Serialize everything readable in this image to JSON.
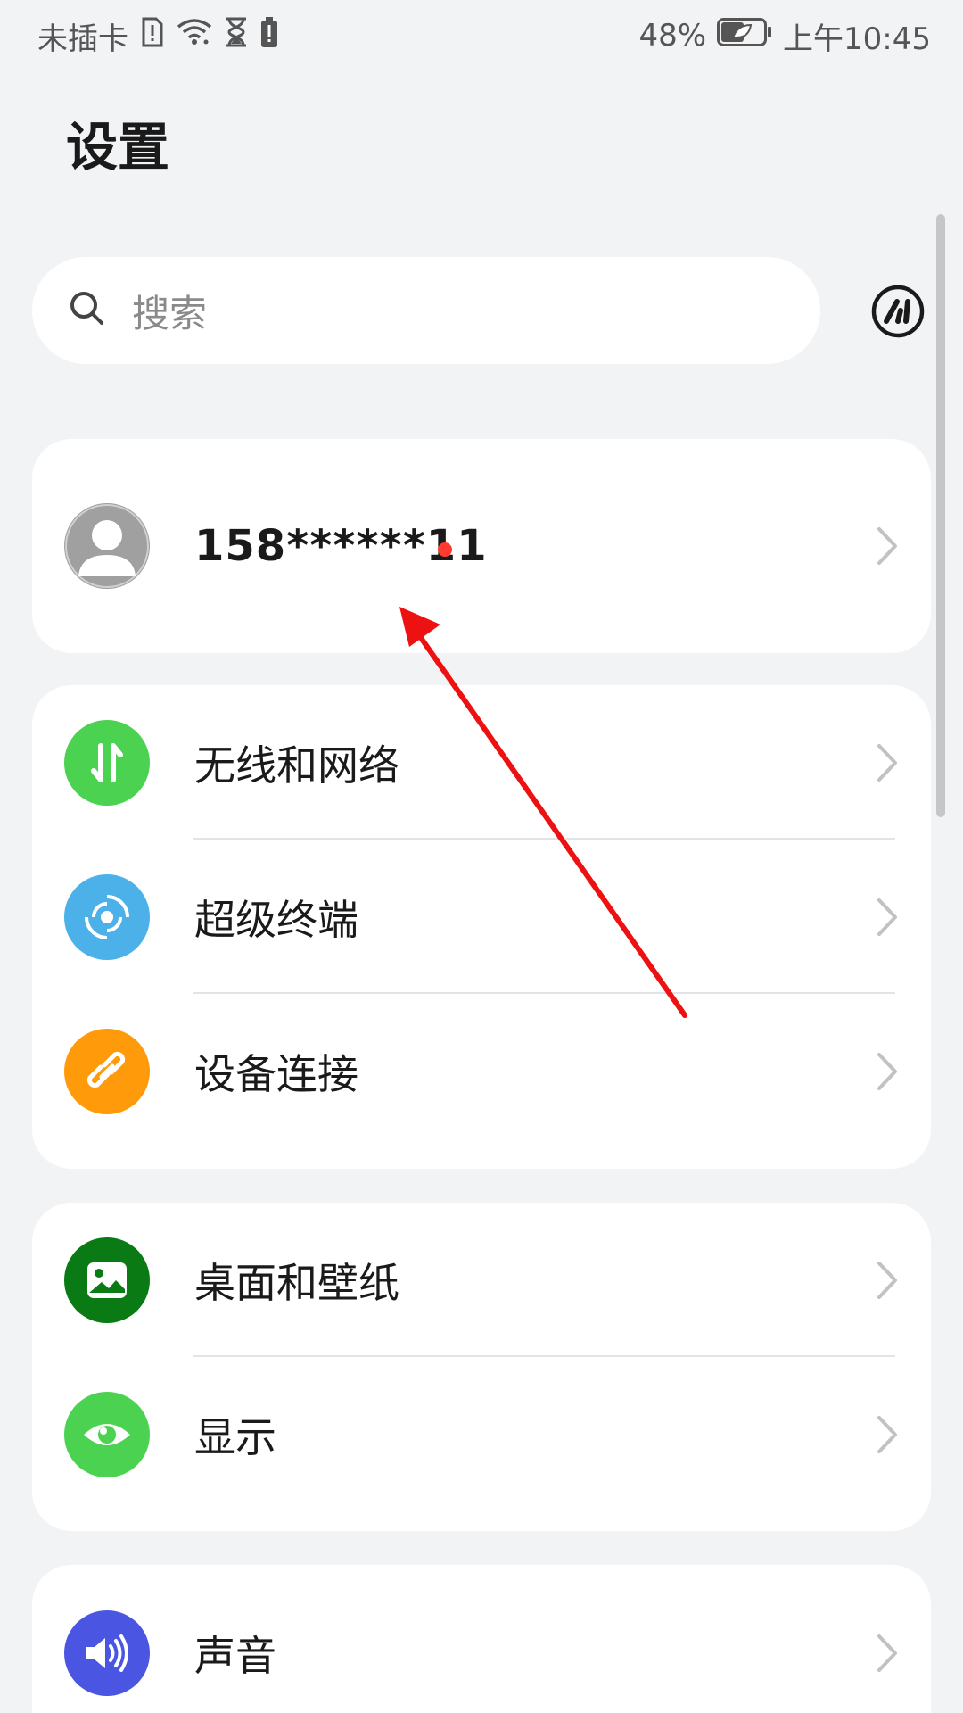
{
  "status_bar": {
    "carrier": "未插卡",
    "battery_percent": "48%",
    "time": "上午10:45"
  },
  "page": {
    "title": "设置"
  },
  "search": {
    "placeholder": "搜索"
  },
  "account": {
    "name": "158******11"
  },
  "groups": [
    {
      "items": [
        {
          "label": "无线和网络",
          "icon": "wireless-network-icon",
          "color": "#4cd251"
        },
        {
          "label": "超级终端",
          "icon": "super-device-icon",
          "color": "#4cb1e8"
        },
        {
          "label": "设备连接",
          "icon": "link-icon",
          "color": "#ff9a0a"
        }
      ]
    },
    {
      "items": [
        {
          "label": "桌面和壁纸",
          "icon": "wallpaper-icon",
          "color": "#0a7a14"
        },
        {
          "label": "显示",
          "icon": "eye-icon",
          "color": "#4cd251"
        }
      ]
    },
    {
      "items": [
        {
          "label": "声音",
          "icon": "speaker-icon",
          "color": "#4a56e2"
        }
      ]
    }
  ],
  "colors": {
    "background": "#f1f3f5",
    "annotation_arrow": "#ee1111",
    "notification_dot": "#ff3b30"
  }
}
